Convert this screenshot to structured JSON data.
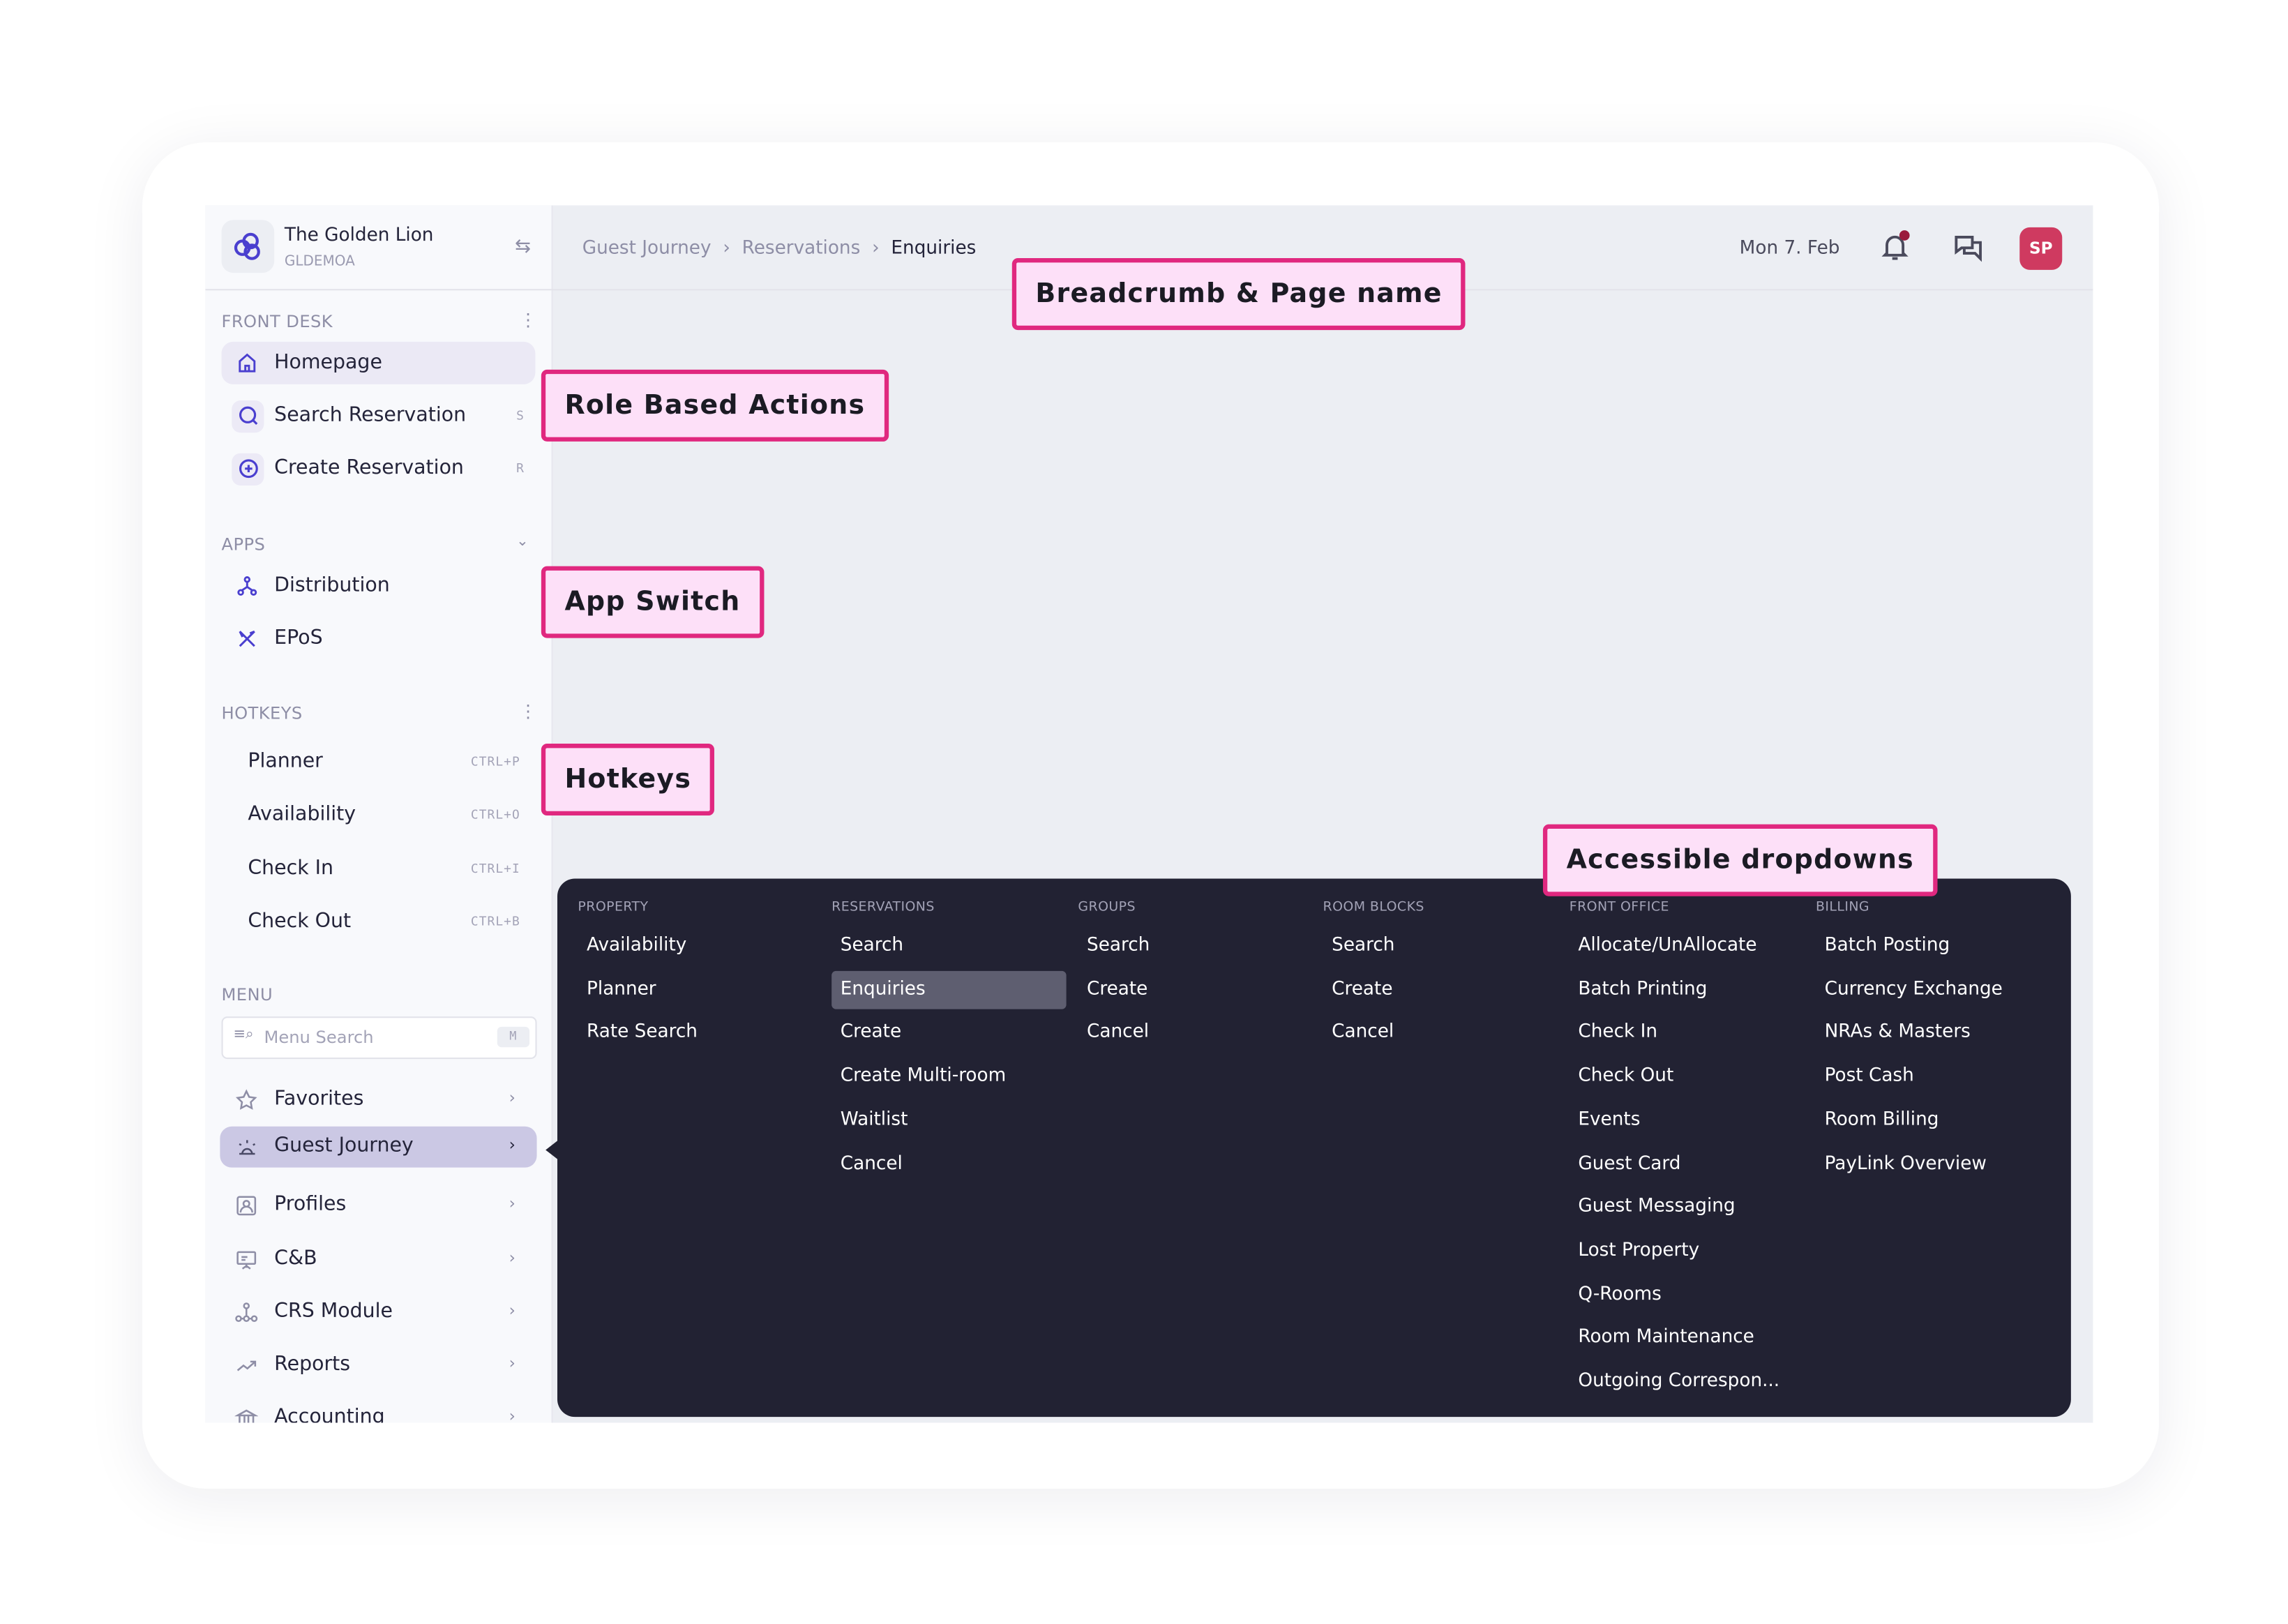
{
  "property": {
    "name": "The Golden Lion",
    "code": "GLDEMOA"
  },
  "breadcrumb": [
    "Guest Journey",
    "Reservations",
    "Enquiries"
  ],
  "header": {
    "date": "Mon 7. Feb",
    "avatar_initials": "SP",
    "avatar_color": "#cf3a60",
    "notification_dot_color": "#9a1a3c"
  },
  "sidebar": {
    "front_desk": {
      "title": "FRONT DESK",
      "items": [
        {
          "label": "Homepage",
          "icon": "home-icon",
          "shortcut": "",
          "active": true
        },
        {
          "label": "Search Reservation",
          "icon": "search-icon",
          "shortcut": "S"
        },
        {
          "label": "Create Reservation",
          "icon": "plus-circle-icon",
          "shortcut": "R"
        }
      ]
    },
    "apps": {
      "title": "APPS",
      "items": [
        {
          "label": "Distribution",
          "icon": "distribution-icon"
        },
        {
          "label": "EPoS",
          "icon": "utensils-icon"
        }
      ]
    },
    "hotkeys": {
      "title": "HOTKEYS",
      "items": [
        {
          "label": "Planner",
          "shortcut": "CTRL+P"
        },
        {
          "label": "Availability",
          "shortcut": "CTRL+O"
        },
        {
          "label": "Check In",
          "shortcut": "CTRL+I"
        },
        {
          "label": "Check Out",
          "shortcut": "CTRL+B"
        }
      ]
    },
    "menu": {
      "title": "MENU",
      "search_placeholder": "Menu Search",
      "search_shortcut": "M",
      "items": [
        {
          "label": "Favorites",
          "icon": "star-icon"
        },
        {
          "label": "Guest Journey",
          "icon": "sunrise-icon",
          "active": true
        },
        {
          "label": "Profiles",
          "icon": "profile-icon"
        },
        {
          "label": "C&B",
          "icon": "presentation-icon"
        },
        {
          "label": "CRS Module",
          "icon": "network-icon"
        },
        {
          "label": "Reports",
          "icon": "trend-icon"
        },
        {
          "label": "Accounting",
          "icon": "bank-icon"
        }
      ]
    }
  },
  "dropdown": {
    "columns": [
      {
        "title": "PROPERTY",
        "items": [
          "Availability",
          "Planner",
          "Rate Search"
        ]
      },
      {
        "title": "RESERVATIONS",
        "items": [
          "Search",
          "Enquiries",
          "Create",
          "Create Multi-room",
          "Waitlist",
          "Cancel"
        ],
        "selected": "Enquiries"
      },
      {
        "title": "GROUPS",
        "items": [
          "Search",
          "Create",
          "Cancel"
        ]
      },
      {
        "title": "ROOM BLOCKS",
        "items": [
          "Search",
          "Create",
          "Cancel"
        ]
      },
      {
        "title": "FRONT OFFICE",
        "items": [
          "Allocate/UnAllocate",
          "Batch Printing",
          "Check In",
          "Check Out",
          "Events",
          "Guest Card",
          "Guest Messaging",
          "Lost Property",
          "Q-Rooms",
          "Room Maintenance",
          "Outgoing Correspon..."
        ]
      },
      {
        "title": "BILLING",
        "items": [
          "Batch Posting",
          "Currency Exchange",
          "NRAs & Masters",
          "Post Cash",
          "Room Billing",
          "PayLink Overview"
        ]
      }
    ]
  },
  "annotations": {
    "breadcrumb": "Breadcrumb & Page name",
    "role": "Role Based Actions",
    "apps": "App Switch",
    "hotkeys": "Hotkeys",
    "dropdowns": "Accessible dropdowns"
  },
  "colors": {
    "accent": "#4a3fcf",
    "annotation_border": "#e0287f",
    "annotation_fill": "#fde0f8",
    "dropdown_bg": "#222233"
  }
}
